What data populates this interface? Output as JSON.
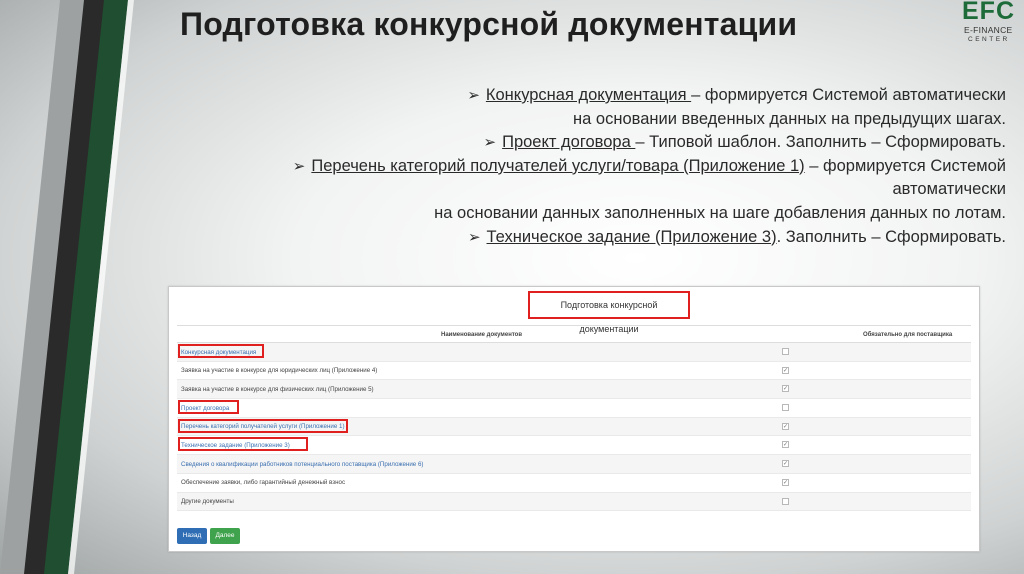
{
  "title": "Подготовка конкурсной документации",
  "logo": {
    "brand": "EFC",
    "line1": "E-FINANCE",
    "line2": "CENTER",
    "brand_color": "#1e6b3a"
  },
  "bullets": {
    "b1_link": "Конкурсная документация ",
    "b1_rest": "– формируется Системой автоматически",
    "b1_cont": "на основании введенных данных на предыдущих шагах.",
    "b2_link": "Проект договора ",
    "b2_rest": "– Типовой шаблон. Заполнить – Сформировать.",
    "b3_link": "Перечень категорий получателей услуги/товара (Приложение 1)",
    "b3_rest": " – формируется Системой",
    "b3_cont1": "автоматически",
    "b3_cont2": "на основании данных заполненных на шаге добавления данных по лотам.",
    "b4_link": "Техническое задание (Приложение 3)",
    "b4_rest": ". Заполнить – Сформировать."
  },
  "screen": {
    "title": "Подготовка конкурсной документации",
    "col_name": "Наименование документов",
    "col_required": "Обязательно для поставщика",
    "rows": [
      {
        "label": "Конкурсная документация",
        "checked": false
      },
      {
        "label": "Заявка на участие в конкурсе для юридических лиц (Приложение 4)",
        "checked": true
      },
      {
        "label": "Заявка на участие в конкурсе для физических лиц (Приложение 5)",
        "checked": true
      },
      {
        "label": "Проект договора",
        "checked": false
      },
      {
        "label": "Перечень категорий получателей услуги (Приложение 1)",
        "checked": true
      },
      {
        "label": "Техническое задание (Приложение 3)",
        "checked": true
      },
      {
        "label": "Сведения о квалификации работников потенциального поставщика (Приложение 6)",
        "checked": true
      },
      {
        "label": "Обеспечение заявки, либо гарантийный денежный взнос",
        "checked": true
      },
      {
        "label": "Другие документы",
        "checked": false
      }
    ],
    "back_label": "Назад",
    "next_label": "Далее",
    "highlight_color": "#e0201e",
    "link_color": "#3a6fb0"
  }
}
